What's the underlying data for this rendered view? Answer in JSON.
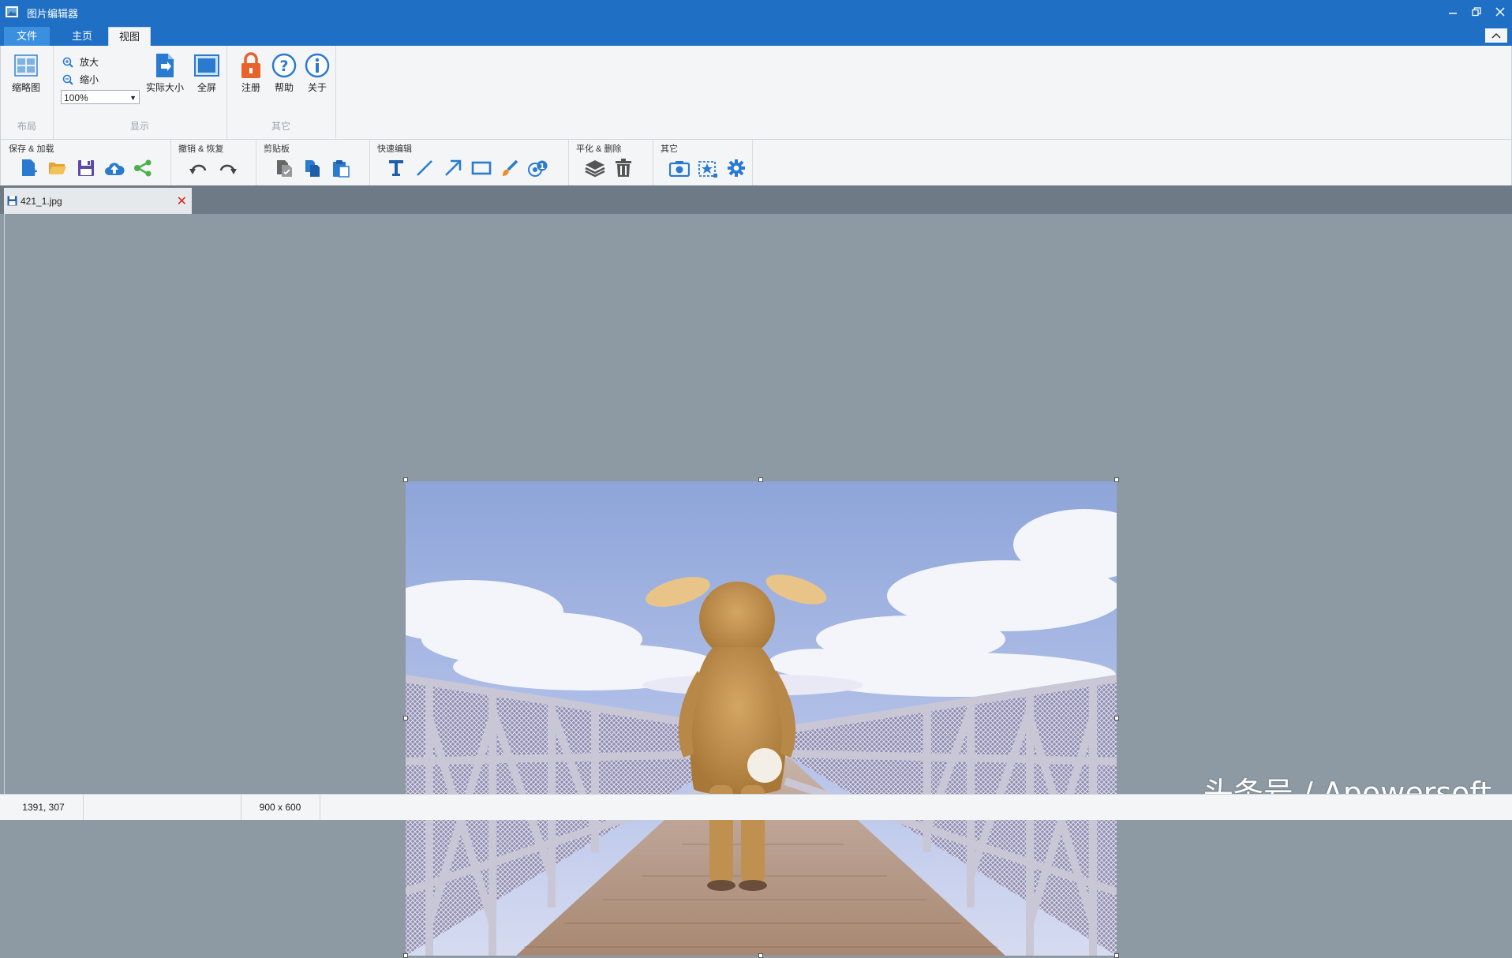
{
  "window": {
    "title": "图片编辑器"
  },
  "ribbon_tabs": [
    {
      "label": "文件"
    },
    {
      "label": "主页"
    },
    {
      "label": "视图"
    }
  ],
  "ribbon": {
    "layout_group": {
      "label": "布局",
      "thumbnail_label": "缩略图"
    },
    "display_group": {
      "label": "显示",
      "zoom_in_label": "放大",
      "zoom_out_label": "缩小",
      "zoom_value": "100%",
      "actual_size_label": "实际大小",
      "fullscreen_label": "全屏"
    },
    "other_group": {
      "label": "其它",
      "register_label": "注册",
      "help_label": "帮助",
      "about_label": "关于"
    }
  },
  "toolbar": {
    "save_load_label": "保存 & 加载",
    "undo_redo_label": "撤销 & 恢复",
    "clipboard_label": "剪贴板",
    "quick_edit_label": "快速编辑",
    "flatten_delete_label": "平化 & 删除",
    "other_label": "其它"
  },
  "document": {
    "tab_name": "421_1.jpg"
  },
  "status": {
    "coords": "1391, 307",
    "empty": "",
    "dimensions": "900 x 600"
  },
  "watermark": "头条号 / Apowersoft",
  "colors": {
    "titlebar": "#1f6fc5",
    "canvas": "#8d9aa3",
    "accent": "#2a7ad0",
    "orange": "#f08a24",
    "green": "#4cb04a"
  }
}
